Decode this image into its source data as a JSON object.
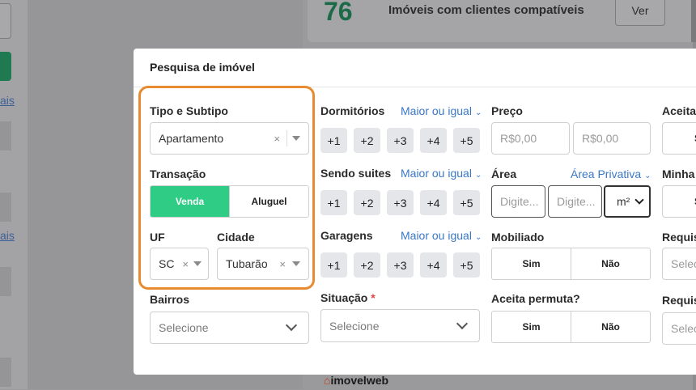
{
  "background": {
    "links": [
      "ais",
      "ais"
    ],
    "summary_count": "76",
    "summary_label": "Imóveis com clientes compatíveis",
    "ver_button": "Ver",
    "logo_brand": "imovel",
    "logo_suffix": "web"
  },
  "modal": {
    "title": "Pesquisa de imóvel",
    "tipo": {
      "label": "Tipo e Subtipo",
      "value": "Apartamento",
      "clear": "×"
    },
    "transacao": {
      "label": "Transação",
      "options": [
        "Venda",
        "Aluguel"
      ],
      "selected": "Venda"
    },
    "uf": {
      "label": "UF",
      "value": "SC",
      "clear": "×"
    },
    "cidade": {
      "label": "Cidade",
      "value": "Tubarão",
      "clear": "×"
    },
    "bairros": {
      "label": "Bairros",
      "placeholder": "Selecione"
    },
    "dormitorios": {
      "label": "Dormitórios",
      "comparator": "Maior ou igual",
      "chips": [
        "+1",
        "+2",
        "+3",
        "+4",
        "+5"
      ]
    },
    "suites": {
      "label": "Sendo suites",
      "comparator": "Maior ou igual",
      "chips": [
        "+1",
        "+2",
        "+3",
        "+4",
        "+5"
      ]
    },
    "garagens": {
      "label": "Garagens",
      "comparator": "Maior ou igual",
      "chips": [
        "+1",
        "+2",
        "+3",
        "+4",
        "+5"
      ]
    },
    "situacao": {
      "label": "Situação",
      "required_mark": "*",
      "placeholder": "Selecione"
    },
    "preco": {
      "label": "Preço",
      "min_placeholder": "R$0,00",
      "max_placeholder": "R$0,00"
    },
    "area": {
      "label": "Área",
      "type": "Área Privativa",
      "min_placeholder": "Digite...",
      "max_placeholder": "Digite...",
      "unit": "m²"
    },
    "mobiliado": {
      "label": "Mobiliado",
      "options": [
        "Sim",
        "Não"
      ]
    },
    "aceita_permuta": {
      "label": "Aceita permuta?",
      "options": [
        "Sim",
        "Não"
      ]
    },
    "col4": {
      "labels": [
        "Aceita",
        "Minha c",
        "Requis",
        "Requis"
      ],
      "cut_placeholders": [
        "Selec",
        "Selec"
      ],
      "cut_chips": [
        "S",
        "S"
      ]
    }
  },
  "colors": {
    "accent_green": "#2ecc85",
    "link_blue": "#3a77c7",
    "highlight_orange": "#e88a30"
  },
  "icons": [
    "clear-x-icon",
    "dropdown-triangle-icon",
    "chevron-down-icon",
    "caret-down-icon"
  ]
}
